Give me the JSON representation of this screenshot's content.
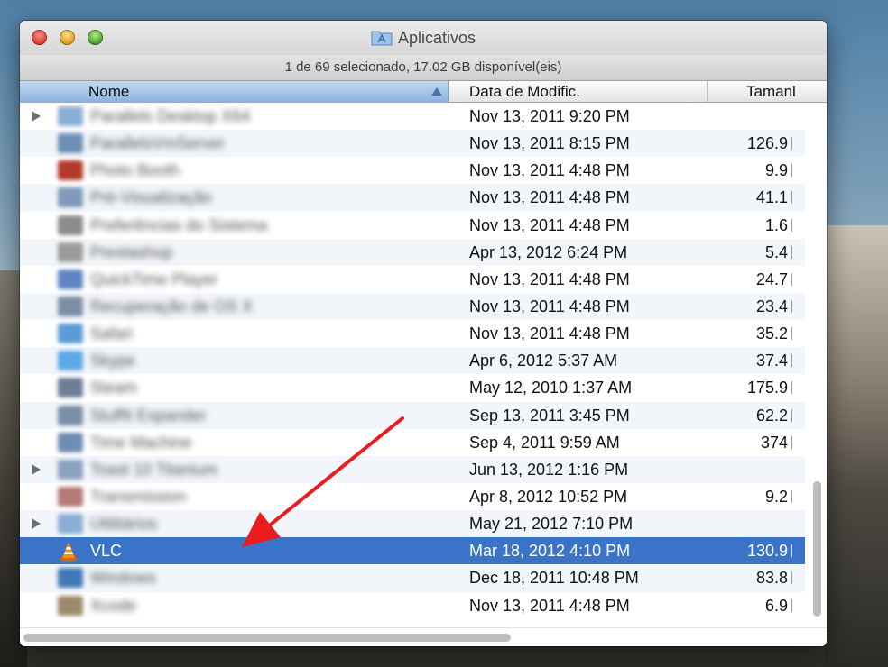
{
  "window": {
    "title": "Aplicativos",
    "status": "1 de 69 selecionado, 17.02 GB disponível(eis)"
  },
  "columns": {
    "name": "Nome",
    "date": "Data de Modific.",
    "size": "Tamanl"
  },
  "rows": [
    {
      "name": "Parallels Desktop X64",
      "date": "Nov 13, 2011 9:20 PM",
      "size": "",
      "expandable": true,
      "icon_color": "#8aaed4"
    },
    {
      "name": "ParallelsVmServer",
      "date": "Nov 13, 2011 8:15 PM",
      "size": "126.9",
      "expandable": false,
      "icon_color": "#6e8fb5"
    },
    {
      "name": "Photo Booth",
      "date": "Nov 13, 2011 4:48 PM",
      "size": "9.9",
      "expandable": false,
      "icon_color": "#b23b2a"
    },
    {
      "name": "Pré-Visualização",
      "date": "Nov 13, 2011 4:48 PM",
      "size": "41.1",
      "expandable": false,
      "icon_color": "#7f9ab8"
    },
    {
      "name": "Preferências do Sistema",
      "date": "Nov 13, 2011 4:48 PM",
      "size": "1.6",
      "expandable": false,
      "icon_color": "#8c8c8c"
    },
    {
      "name": "Prestashop",
      "date": "Apr 13, 2012 6:24 PM",
      "size": "5.4",
      "expandable": false,
      "icon_color": "#9b9b9b"
    },
    {
      "name": "QuickTime Player",
      "date": "Nov 13, 2011 4:48 PM",
      "size": "24.7",
      "expandable": false,
      "icon_color": "#5f86c2"
    },
    {
      "name": "Recuperação de OS X",
      "date": "Nov 13, 2011 4:48 PM",
      "size": "23.4",
      "expandable": false,
      "icon_color": "#7c8ea6"
    },
    {
      "name": "Safari",
      "date": "Nov 13, 2011 4:48 PM",
      "size": "35.2",
      "expandable": false,
      "icon_color": "#5a9bd8"
    },
    {
      "name": "Skype",
      "date": "Apr 6, 2012 5:37 AM",
      "size": "37.4",
      "expandable": false,
      "icon_color": "#5aa9e6"
    },
    {
      "name": "Steam",
      "date": "May 12, 2010 1:37 AM",
      "size": "175.9",
      "expandable": false,
      "icon_color": "#6d7f96"
    },
    {
      "name": "StuffIt Expander",
      "date": "Sep 13, 2011 3:45 PM",
      "size": "62.2",
      "expandable": false,
      "icon_color": "#7b8fa8"
    },
    {
      "name": "Time Machine",
      "date": "Sep 4, 2011 9:59 AM",
      "size": "374",
      "expandable": false,
      "icon_color": "#6f8db2"
    },
    {
      "name": "Toast 10 Titanium",
      "date": "Jun 13, 2012 1:16 PM",
      "size": "",
      "expandable": true,
      "icon_color": "#8aa2bf"
    },
    {
      "name": "Transmission",
      "date": "Apr 8, 2012 10:52 PM",
      "size": "9.2",
      "expandable": false,
      "icon_color": "#b47a78"
    },
    {
      "name": "Utilitários",
      "date": "May 21, 2012 7:10 PM",
      "size": "",
      "expandable": true,
      "icon_color": "#8aaed4"
    },
    {
      "name": "VLC",
      "date": "Mar 18, 2012 4:10 PM",
      "size": "130.9",
      "expandable": false,
      "selected": true,
      "icon": "vlc-cone-icon"
    },
    {
      "name": "Windows",
      "date": "Dec 18, 2011 10:48 PM",
      "size": "83.8",
      "expandable": false,
      "icon_color": "#3f7ab8"
    },
    {
      "name": "Xcode",
      "date": "Nov 13, 2011 4:48 PM",
      "size": "6.9",
      "expandable": false,
      "icon_color": "#9c8a6a"
    }
  ],
  "colors": {
    "selection": "#3b73c8",
    "arrow": "#e81e1e"
  }
}
